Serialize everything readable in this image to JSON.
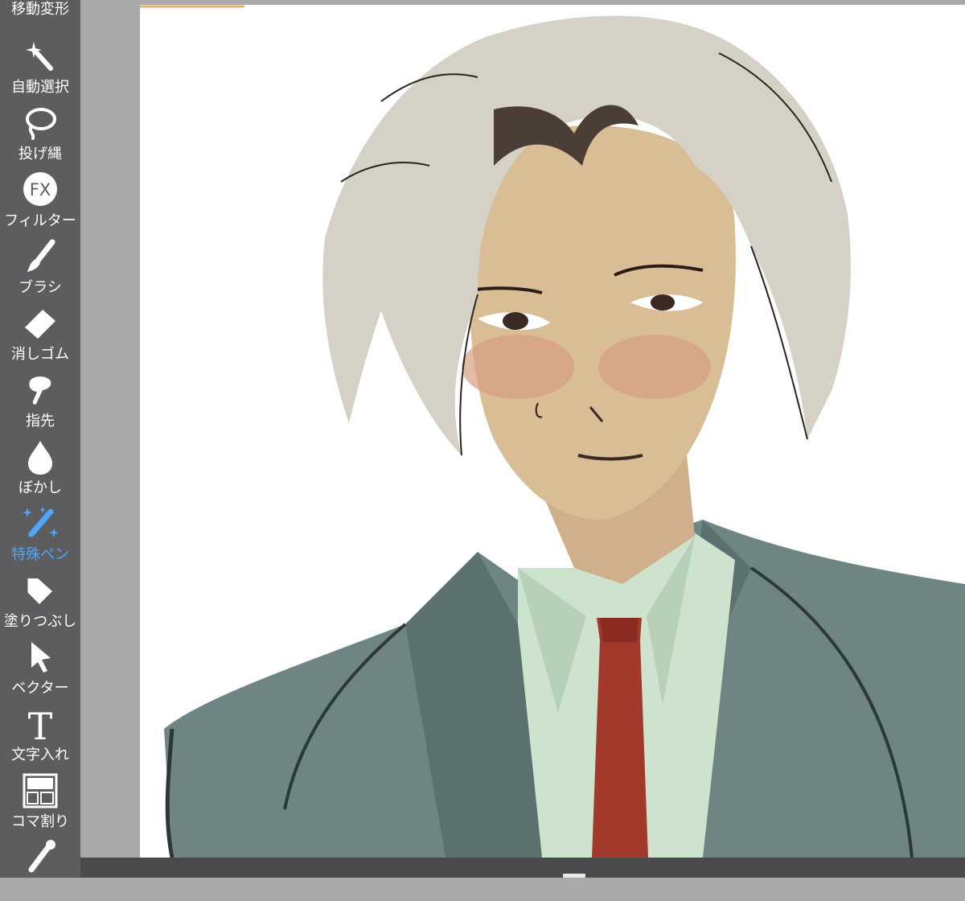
{
  "toolbar": {
    "items": [
      {
        "label": "移動変形",
        "icon": "move-transform-icon"
      },
      {
        "label": "自動選択",
        "icon": "magic-wand-icon"
      },
      {
        "label": "投げ縄",
        "icon": "lasso-icon"
      },
      {
        "label": "フィルター",
        "icon": "fx-filter-icon"
      },
      {
        "label": "ブラシ",
        "icon": "brush-icon"
      },
      {
        "label": "消しゴム",
        "icon": "eraser-icon"
      },
      {
        "label": "指先",
        "icon": "finger-smudge-icon"
      },
      {
        "label": "ぼかし",
        "icon": "blur-drop-icon"
      },
      {
        "label": "特殊ペン",
        "icon": "special-pen-icon",
        "active": true
      },
      {
        "label": "塗りつぶし",
        "icon": "fill-bucket-icon"
      },
      {
        "label": "ベクター",
        "icon": "vector-arrow-icon"
      },
      {
        "label": "文字入れ",
        "icon": "text-icon"
      },
      {
        "label": "コマ割り",
        "icon": "panel-layout-icon"
      },
      {
        "label": "",
        "icon": "eyedropper-icon"
      }
    ],
    "fx_text": "FX",
    "text_glyph": "T"
  },
  "colors": {
    "toolbar_bg": "#5d5d5f",
    "active": "#4fa6ff",
    "workspace": "#a9a9ab",
    "canvas": "#ffffff"
  }
}
